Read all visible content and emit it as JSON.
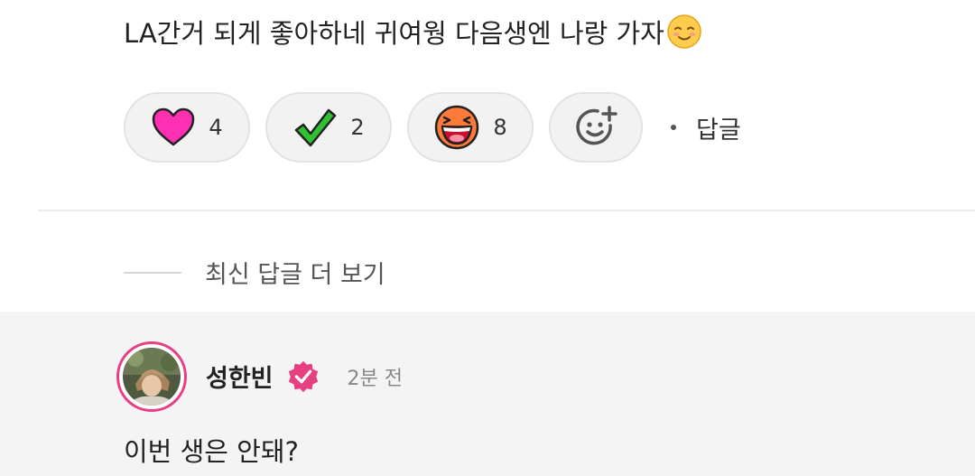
{
  "comment": {
    "text": "LA간거 되게 좋아하네 귀여웡 다음생엔 나랑 가자",
    "emoji_icon": "smiling-face-icon"
  },
  "reactions": [
    {
      "icon": "heart-icon",
      "count": "4",
      "color": "#ff2fb4"
    },
    {
      "icon": "checkmark-icon",
      "count": "2",
      "color": "#2fc22f"
    },
    {
      "icon": "laughing-face-icon",
      "count": "8",
      "color": "#ff7a3a"
    }
  ],
  "add_reaction_icon": "add-emoji-icon",
  "reply_label": "답글",
  "more_replies_label": "최신 답글 더 보기",
  "reply": {
    "author": "성한빈",
    "verified_icon": "verified-badge-icon",
    "timestamp": "2분 전",
    "text": "이번 생은 안돼?"
  },
  "colors": {
    "accent": "#e83f83",
    "reply_background": "#f4f4f5",
    "pill_background": "#f2f2f2"
  }
}
